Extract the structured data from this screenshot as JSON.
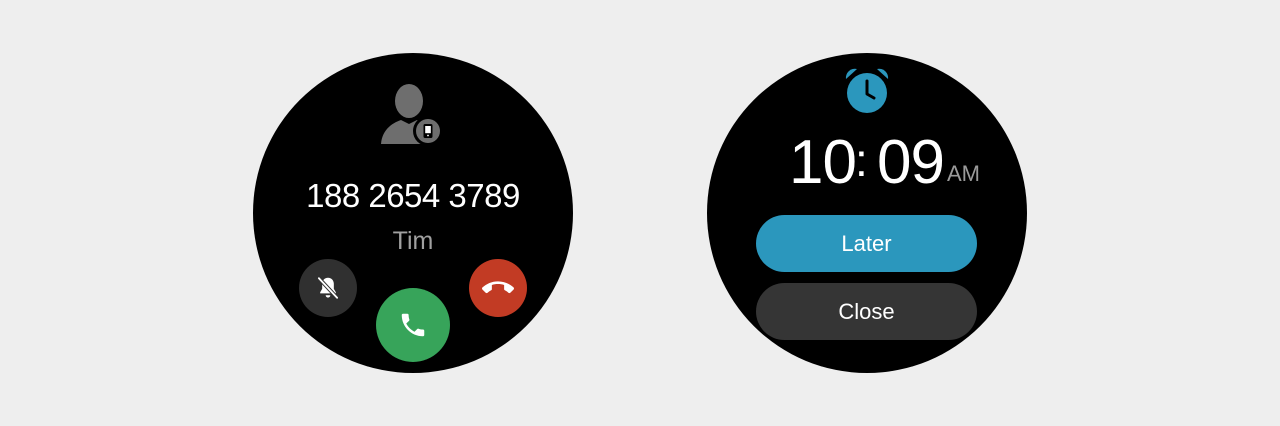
{
  "call_screen": {
    "phone_number": "188 2654 3789",
    "caller_name": "Tim",
    "avatar_icon": "contact-person-with-phone-badge-icon",
    "buttons": {
      "mute": {
        "icon": "bell-off-icon",
        "color": "#303030"
      },
      "answer": {
        "icon": "phone-answer-icon",
        "color": "#37a45a"
      },
      "decline": {
        "icon": "phone-hangup-icon",
        "color": "#c23b24"
      }
    }
  },
  "alarm_screen": {
    "icon": "alarm-clock-icon",
    "icon_color": "#2b97bd",
    "time": {
      "hour": "10",
      "separator": ":",
      "minute": "09",
      "period": "AM"
    },
    "later_label": "Later",
    "close_label": "Close",
    "later_color": "#2b97bd",
    "close_color": "#353535"
  },
  "colors": {
    "background": "#eeeeee",
    "watch_face": "#000000"
  }
}
